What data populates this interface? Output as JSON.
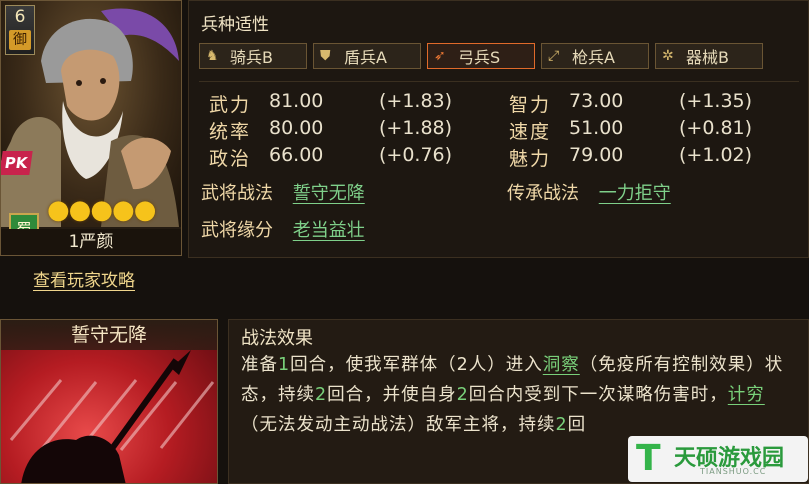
{
  "hero": {
    "cost": "6",
    "type_char": "御",
    "pk_label": "PK",
    "faction": "蜀",
    "stars": "❨❨❨❨❨",
    "name": "1严颜",
    "guide_link": "查看玩家攻略"
  },
  "aptitude": {
    "title": "兵种适性",
    "items": [
      {
        "icon": "horse-icon",
        "glyph": "♞",
        "label": "骑兵B",
        "selected": false
      },
      {
        "icon": "shield-icon",
        "glyph": "⛊",
        "label": "盾兵A",
        "selected": false
      },
      {
        "icon": "bow-icon",
        "glyph": "➶",
        "label": "弓兵S",
        "selected": true
      },
      {
        "icon": "spear-icon",
        "glyph": "⤢",
        "label": "枪兵A",
        "selected": false
      },
      {
        "icon": "gear-icon",
        "glyph": "✲",
        "label": "器械B",
        "selected": false
      }
    ]
  },
  "stats": {
    "left": [
      {
        "label": "武力",
        "value": "81.00",
        "bonus": "(+1.83)"
      },
      {
        "label": "统率",
        "value": "80.00",
        "bonus": "(+1.88)"
      },
      {
        "label": "政治",
        "value": "66.00",
        "bonus": "(+0.76)"
      }
    ],
    "right": [
      {
        "label": "智力",
        "value": "73.00",
        "bonus": "(+1.35)"
      },
      {
        "label": "速度",
        "value": "51.00",
        "bonus": "(+0.81)"
      },
      {
        "label": "魅力",
        "value": "79.00",
        "bonus": "(+1.02)"
      }
    ]
  },
  "skills": {
    "hero_skill_label": "武将战法",
    "hero_skill": "誓守无降",
    "inherit_skill_label": "传承战法",
    "inherit_skill": "一力拒守",
    "fate_label": "武将缘分",
    "fate": "老当益壮"
  },
  "skill_art": {
    "title": "誓守无降"
  },
  "effect": {
    "title": "战法效果",
    "t1": "准备",
    "n1": "1",
    "t2": "回合，使我军群体（2人）进入",
    "k1": "洞察",
    "t3": "（免疫所有控制效果）状态，持续",
    "n2": "2",
    "t4": "回合，并使自身",
    "n3": "2",
    "t5": "回合内受到下一次谋略伤害时，",
    "k2": "计穷",
    "t6": "（无法发动主动战法）敌军主将，持续",
    "n4": "2",
    "t7": "回"
  },
  "watermark": {
    "name": "天硕游戏园",
    "url": "TIANSHUO.CC"
  }
}
